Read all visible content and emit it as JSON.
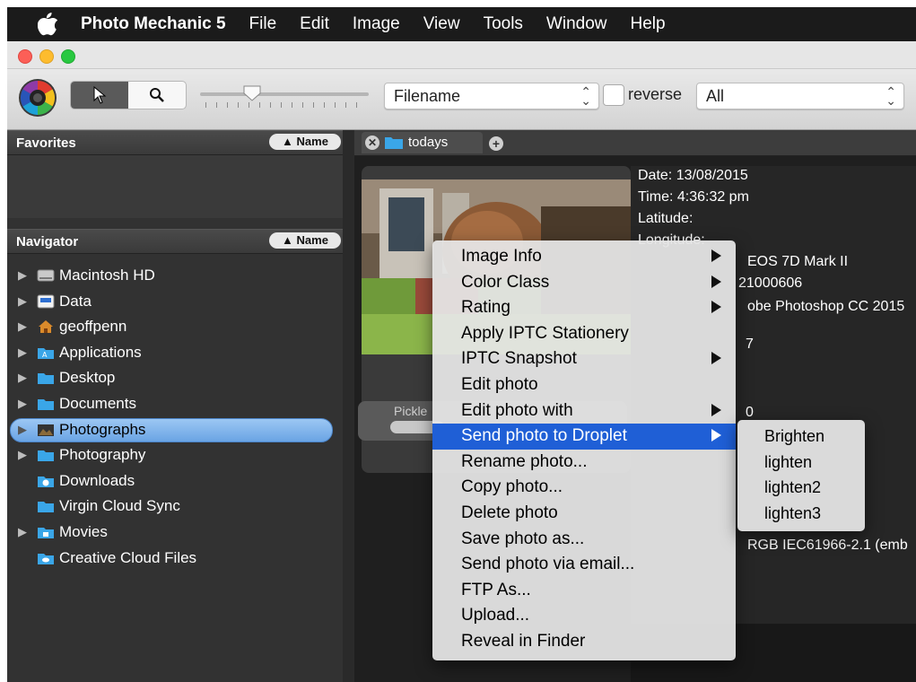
{
  "menubar": {
    "app_name": "Photo Mechanic 5",
    "items": [
      "File",
      "Edit",
      "Image",
      "View",
      "Tools",
      "Window",
      "Help"
    ]
  },
  "toolbar": {
    "sort_select": "Filename",
    "reverse_label": "reverse",
    "filter_select": "All"
  },
  "favorites": {
    "title": "Favorites",
    "sort_button": "▲ Name"
  },
  "navigator": {
    "title": "Navigator",
    "sort_button": "▲ Name",
    "items": [
      {
        "label": "Macintosh HD",
        "expandable": true
      },
      {
        "label": "Data",
        "expandable": true
      },
      {
        "label": "geoffpenn",
        "expandable": true
      },
      {
        "label": "Applications",
        "expandable": true
      },
      {
        "label": "Desktop",
        "expandable": true
      },
      {
        "label": "Documents",
        "expandable": true
      },
      {
        "label": "Photographs",
        "expandable": true,
        "selected": true
      },
      {
        "label": "Photography",
        "expandable": true
      },
      {
        "label": "Downloads",
        "expandable": false
      },
      {
        "label": "Virgin Cloud Sync",
        "expandable": false
      },
      {
        "label": "Movies",
        "expandable": true
      },
      {
        "label": "Creative Cloud Files",
        "expandable": false
      }
    ]
  },
  "tab": {
    "label": "todays"
  },
  "thumbnail": {
    "pick_label": "Pickle"
  },
  "info_panel": {
    "date": "Date: 13/08/2015",
    "time": "Time: 4:36:32 pm",
    "latitude": "Latitude:",
    "longitude": "Longitude:",
    "camera": "EOS 7D Mark II",
    "serial": "21000606",
    "software": "obe Photoshop CC 2015",
    "extra1": "7",
    "extra2": "0",
    "colorspace": "RGB IEC61966-2.1 (emb"
  },
  "context_menu": {
    "items": [
      {
        "label": "Image Info",
        "submenu": true
      },
      {
        "label": "Color Class",
        "submenu": true
      },
      {
        "label": "Rating",
        "submenu": true
      },
      {
        "label": "Apply IPTC Stationery",
        "submenu": false
      },
      {
        "label": "IPTC Snapshot",
        "submenu": true
      },
      {
        "label": "Edit photo",
        "submenu": false
      },
      {
        "label": "Edit photo with",
        "submenu": true
      },
      {
        "label": "Send photo to Droplet",
        "submenu": true,
        "highlighted": true
      },
      {
        "label": "Rename photo...",
        "submenu": false
      },
      {
        "label": "Copy photo...",
        "submenu": false
      },
      {
        "label": "Delete photo",
        "submenu": false
      },
      {
        "label": "Save photo as...",
        "submenu": false
      },
      {
        "label": "Send photo via email...",
        "submenu": false
      },
      {
        "label": "FTP As...",
        "submenu": false
      },
      {
        "label": "Upload...",
        "submenu": false
      },
      {
        "label": "Reveal in Finder",
        "submenu": false
      }
    ]
  },
  "droplet_submenu": {
    "items": [
      "Brighten",
      "lighten",
      "lighten2",
      "lighten3"
    ]
  },
  "colors": {
    "highlight": "#1f5fd6",
    "selection": "#7fb3ec",
    "folder": "#3aa6e8"
  },
  "icons": {
    "apple": "apple-logo-icon",
    "app_logo": "photo-mechanic-logo-icon",
    "arrow_tool": "arrow-pointer-icon",
    "zoom_tool": "magnifier-icon"
  }
}
